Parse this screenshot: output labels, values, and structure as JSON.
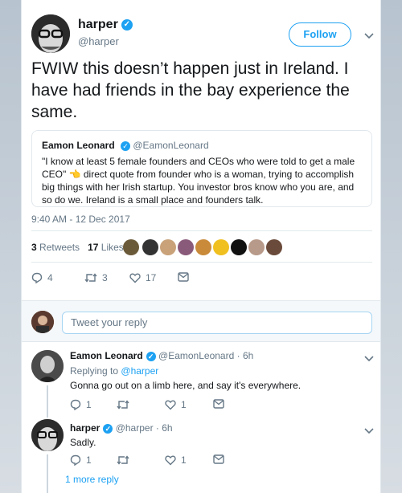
{
  "tweet": {
    "author_name": "harper",
    "author_handle": "@harper",
    "follow_label": "Follow",
    "text": "FWIW this doesn’t happen just in Ireland. I have had friends in the bay experience the same.",
    "timestamp": "9:40 AM - 12 Dec 2017",
    "retweets_count": "3",
    "retweets_label": "Retweets",
    "likes_count": "17",
    "likes_label": "Likes",
    "actions": {
      "replies": "4",
      "retweets": "3",
      "likes": "17"
    }
  },
  "quoted": {
    "author_name": "Eamon Leonard",
    "author_handle": "@EamonLeonard",
    "text": "\"I know at least 5 female founders and CEOs who were told to get a male CEO\" 👈 direct quote from founder who is a woman, trying to accomplish big things with her Irish startup. You investor bros know who you are, and so do we. Ireland is a small place and founders talk."
  },
  "reply_box": {
    "placeholder": "Tweet your reply"
  },
  "replies": [
    {
      "author_name": "Eamon Leonard",
      "author_handle": "@EamonLeonard · 6h",
      "replying_to_prefix": "Replying to",
      "replying_to": "@harper",
      "text": "Gonna go out on a limb here, and say it's everywhere.",
      "replies": "1",
      "retweets": "",
      "likes": "1"
    },
    {
      "author_name": "harper",
      "author_handle": "@harper · 6h",
      "text": "Sadly.",
      "replies": "1",
      "retweets": "",
      "likes": "1"
    }
  ],
  "more_replies_label": "1 more reply",
  "colors": {
    "accent": "#1da1f2",
    "muted": "#657786",
    "border": "#e1e8ed"
  },
  "icons": [
    "verified-badge-icon",
    "chevron-down-icon",
    "reply-icon",
    "retweet-icon",
    "like-icon",
    "message-icon"
  ]
}
